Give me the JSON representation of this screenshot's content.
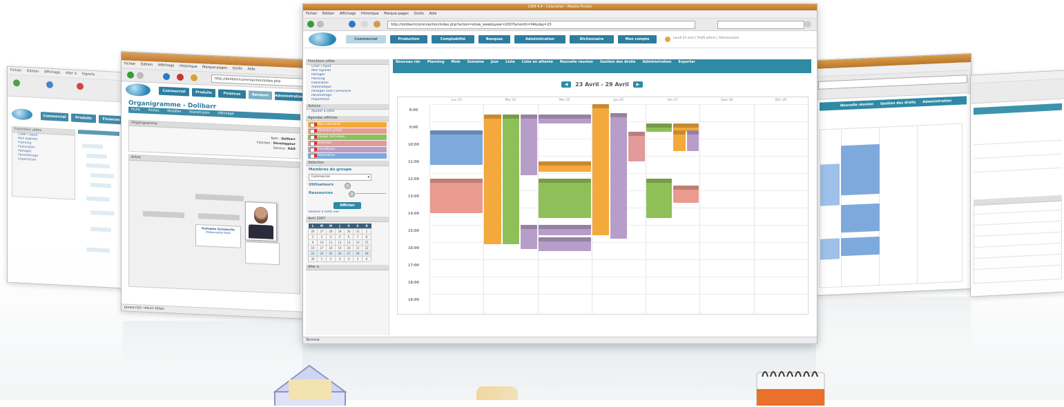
{
  "main_window": {
    "title": "DSM 4.4 - Calendrier - Mozilla Firefox",
    "menu": [
      "Fichier",
      "Édition",
      "Affichage",
      "Historique",
      "Marque-pages",
      "Outils",
      "Aide"
    ],
    "url": "http://dolibarr/comm/action/index.php?action=show_week&year=2007&month=04&day=23",
    "nav_tabs": [
      "Commercial",
      "Production",
      "Comptabilité",
      "Banques",
      "Administration",
      "Dictionnaire",
      "Mon compte"
    ],
    "toolbar_right": "Lundi 23 avril | Profil admin | Déconnexion",
    "left_panel": {
      "header": "Fonctions utiles",
      "items": [
        "Créer / Ajout",
        "Mon Agenda",
        "Partagés",
        "Planning",
        "Publication",
        "Automatique",
        "Partagés avec Formulaire",
        "Paramétrage",
        "Importation"
      ],
      "actions_header": "Actions",
      "actions_link": "Ajouter à cette",
      "agendas_header": "Agendas affichés",
      "agendas": [
        {
          "label": "Mon calendrier",
          "color": "#f4a93c"
        },
        {
          "label": "Réunions projet",
          "color": "#e89b8e"
        },
        {
          "label": "Équipe technique",
          "color": "#8fbf59"
        },
        {
          "label": "Direction",
          "color": "#e29a9a"
        },
        {
          "label": "Formations",
          "color": "#b79ec8"
        },
        {
          "label": "Partenaires",
          "color": "#7ea9dd"
        }
      ],
      "selection_header": "Sélection",
      "members_label": "Membres du groupe",
      "members_select": "Commercial",
      "utilisateurs_label": "Utilisateurs",
      "ressources_label": "Ressources",
      "afficher_btn": "Afficher",
      "reset_link": "Revenir à cette vue",
      "mini_cal_header": "Avril 2007",
      "mini_days": [
        "L",
        "M",
        "M",
        "J",
        "V",
        "S",
        "D"
      ],
      "mini_weeks": [
        [
          "26",
          "27",
          "28",
          "29",
          "30",
          "31",
          "1"
        ],
        [
          "2",
          "3",
          "4",
          "5",
          "6",
          "7",
          "8"
        ],
        [
          "9",
          "10",
          "11",
          "12",
          "13",
          "14",
          "15"
        ],
        [
          "16",
          "17",
          "18",
          "19",
          "20",
          "21",
          "22"
        ],
        [
          "23",
          "24",
          "25",
          "26",
          "27",
          "28",
          "29"
        ],
        [
          "30",
          "1",
          "2",
          "3",
          "4",
          "5",
          "6"
        ]
      ],
      "aller_a": "Aller à"
    },
    "view_tabs": [
      "Nouveau rdv",
      "Planning",
      "Mois",
      "Semaine",
      "Jour",
      "Liste",
      "Liste en attente",
      "Nouvelle réunion",
      "Gestion des droits",
      "Administration",
      "Exporter"
    ],
    "week_label": "23 Avril - 29 Avril",
    "day_headers": [
      "Lun 23",
      "Mar 24",
      "Mer 25",
      "Jeu 26",
      "Ven 27",
      "Sam 28",
      "Dim 29"
    ],
    "hours": [
      "8:00",
      "9:00",
      "10:00",
      "11:00",
      "12:00",
      "13:00",
      "14:00",
      "15:00",
      "16:00",
      "17:00",
      "18:00",
      "19:00"
    ],
    "status": "Terminé"
  },
  "left_window": {
    "title": "Organigramme - Dolibarr",
    "section": "Organigramme - Dolibarr",
    "menu": [
      "Fichier",
      "Édition",
      "Affichage",
      "Historique",
      "Marque-pages",
      "Outils",
      "Aide"
    ],
    "tabs": [
      "Commercial",
      "Produits",
      "Finances",
      "Banques",
      "Administration"
    ],
    "sub_tabs": [
      "Fiche",
      "Postes",
      "Modifier",
      "Statistiques",
      "Affichage"
    ],
    "info_header": "Organigramme",
    "fields": [
      {
        "label": "Nom",
        "value": "Dolibarr"
      },
      {
        "label": "Fonction",
        "value": "Développeur"
      },
      {
        "label": "Service",
        "value": "R&D"
      }
    ],
    "tree_header": "Arbre",
    "tree_nodes": [
      "Direction",
      "Commercial",
      "Technique"
    ],
    "person_name": "Rodolphe Quiedeville",
    "person_role": "Responsable R&D",
    "status": "Javascript: return false;"
  },
  "far_left_window": {
    "menu": [
      "Fichier",
      "Édition",
      "Affichage",
      "Aller à",
      "Signets",
      "Outils",
      "Aide"
    ],
    "tabs": [
      "Commercial",
      "Produits",
      "Finances"
    ],
    "panel_header": "Fonctions utiles",
    "items": [
      "Créer / Ajout",
      "Mon Agenda",
      "Planning",
      "Publication",
      "Partagés",
      "Paramétrage",
      "Importation"
    ]
  },
  "right_window": {
    "tabs": [
      "Nouvelle réunion",
      "Gestion des droits",
      "Administration"
    ]
  }
}
